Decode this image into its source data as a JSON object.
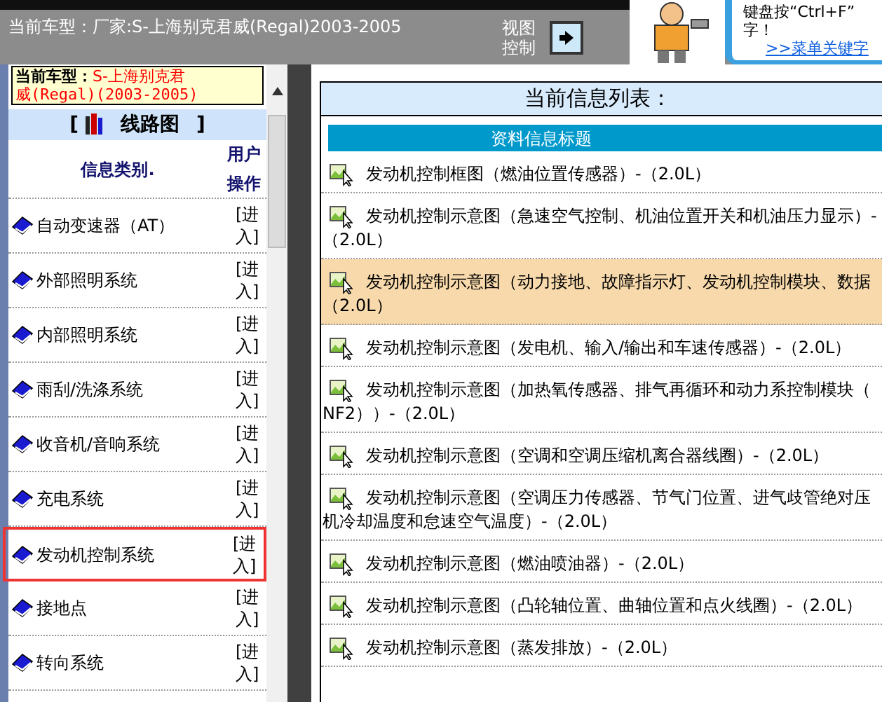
{
  "header": {
    "current_model": "当前车型：厂家:S-上海别克君威(Regal)2003-2005",
    "view_control": "视图控制",
    "tip_lines": [
      "键盘按“Ctrl+F”",
      "字！"
    ],
    "tip_link": ">>菜单关键字"
  },
  "sidebar": {
    "model_label": "当前车型：",
    "model_value_1": "S-上海别克君",
    "model_value_2": "威(Regal)(2003-2005)",
    "section_title": "[",
    "section_name": "线路图",
    "section_close": "]",
    "column_category": "信息类别.",
    "column_action": "用户操作",
    "items": [
      {
        "label": "自动变速器（AT）",
        "action": "[进入]",
        "selected": false
      },
      {
        "label": "外部照明系统",
        "action": "[进入]",
        "selected": false
      },
      {
        "label": "内部照明系统",
        "action": "[进入]",
        "selected": false
      },
      {
        "label": "雨刮/洗涤系统",
        "action": "[进入]",
        "selected": false
      },
      {
        "label": "收音机/音响系统",
        "action": "[进入]",
        "selected": false
      },
      {
        "label": "充电系统",
        "action": "[进入]",
        "selected": false
      },
      {
        "label": "发动机控制系统",
        "action": "[进入]",
        "selected": true
      },
      {
        "label": "接地点",
        "action": "[进入]",
        "selected": false
      },
      {
        "label": "转向系统",
        "action": "[进入]",
        "selected": false
      }
    ]
  },
  "main": {
    "title": "当前信息列表：",
    "column": "资料信息标题",
    "items": [
      {
        "lines": [
          "发动机控制框图（燃油位置传感器）-（2.0L）"
        ],
        "selected": false
      },
      {
        "lines": [
          "发动机控制示意图（急速空气控制、机油位置开关和机油压力显示）-",
          "（2.0L）"
        ],
        "selected": false
      },
      {
        "lines": [
          "发动机控制示意图（动力接地、故障指示灯、发动机控制模块、数据",
          "（2.0L）"
        ],
        "selected": true
      },
      {
        "lines": [
          "发动机控制示意图（发电机、输入/输出和车速传感器）-（2.0L）"
        ],
        "selected": false
      },
      {
        "lines": [
          "发动机控制示意图（加热氧传感器、排气再循环和动力系控制模块（",
          "NF2））-（2.0L）"
        ],
        "selected": false
      },
      {
        "lines": [
          "发动机控制示意图（空调和空调压缩机离合器线圈）-（2.0L）"
        ],
        "selected": false
      },
      {
        "lines": [
          "发动机控制示意图（空调压力传感器、节气门位置、进气歧管绝对压",
          "机冷却温度和怠速空气温度）-（2.0L）"
        ],
        "selected": false
      },
      {
        "lines": [
          "发动机控制示意图（燃油喷油器）-（2.0L）"
        ],
        "selected": false
      },
      {
        "lines": [
          "发动机控制示意图（凸轮轴位置、曲轴位置和点火线圈）-（2.0L）"
        ],
        "selected": false
      },
      {
        "lines": [
          "发动机控制示意图（蒸发排放）-（2.0L）"
        ],
        "selected": false
      }
    ]
  }
}
